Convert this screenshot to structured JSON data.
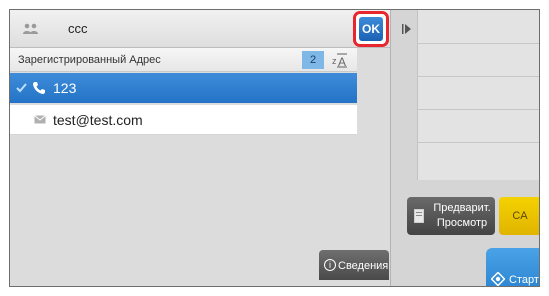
{
  "header": {
    "address_name": "ccc",
    "ok_label": "OK"
  },
  "section": {
    "title": "Зарегистрированный Адрес",
    "count": "2"
  },
  "items": [
    {
      "label": "123",
      "type": "phone",
      "selected": true
    },
    {
      "label": "test@test.com",
      "type": "email",
      "selected": false
    }
  ],
  "info_button": {
    "label": "Сведения"
  },
  "preview_button": {
    "label": "Предварит. Просмотр"
  },
  "ca_button": {
    "label": "CA"
  },
  "start_button": {
    "label": "Старт"
  },
  "icons": {
    "group": "people-icon",
    "sort": "sort-icon",
    "check": "check-icon",
    "phone": "phone-icon",
    "email": "mail-icon",
    "info": "info-icon",
    "expand": "expand-arrow-icon",
    "preview": "preview-icon",
    "start": "start-icon"
  },
  "colors": {
    "selected_row": "#2a78c8",
    "ok_button": "#2568bb",
    "highlight_border": "#e8262d",
    "ca_button": "#e7bd00",
    "start_button": "#2f89d8"
  }
}
